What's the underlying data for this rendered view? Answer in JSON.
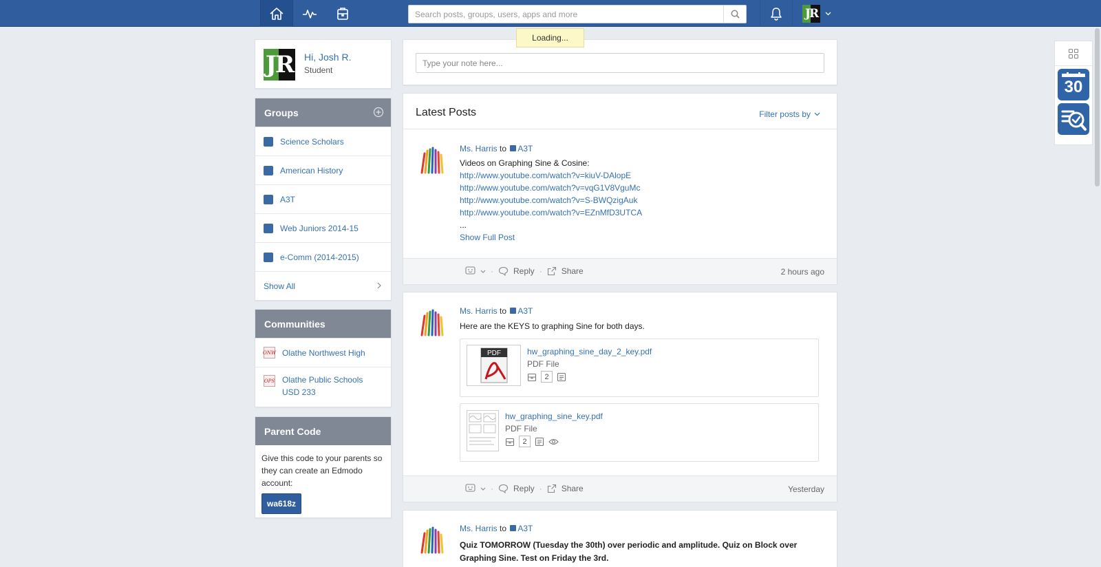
{
  "topbar": {
    "search_placeholder": "Search posts, groups, users, apps and more",
    "loading_text": "Loading...",
    "nav": [
      "home-icon",
      "activity-icon",
      "backpack-icon"
    ]
  },
  "profile": {
    "greeting": "Hi, Josh R.",
    "role": "Student",
    "avatar_letters": "JR"
  },
  "groups": {
    "title": "Groups",
    "items": [
      {
        "label": "Science Scholars"
      },
      {
        "label": "American History"
      },
      {
        "label": "A3T"
      },
      {
        "label": "Web Juniors 2014-15"
      },
      {
        "label": "e-Comm (2014-2015)"
      }
    ],
    "show_all": "Show All"
  },
  "communities": {
    "title": "Communities",
    "items": [
      {
        "label": "Olathe Northwest High"
      },
      {
        "label": "Olathe Public Schools USD 233"
      }
    ]
  },
  "parent_code": {
    "title": "Parent Code",
    "description": "Give this code to your parents so they can create an Edmodo account:",
    "code": "wa618z"
  },
  "note": {
    "placeholder": "Type your note here..."
  },
  "feed": {
    "title": "Latest Posts",
    "filter_label": "Filter posts by",
    "posts": [
      {
        "sender": "Ms. Harris",
        "to": "to",
        "group": "A3T",
        "text": "Videos on Graphing Sine & Cosine:",
        "links": [
          "http://www.youtube.com/watch?v=kiuV-DAlopE",
          "http://www.youtube.com/watch?v=vqG1V8VguMc",
          "http://www.youtube.com/watch?v=S-BWQzigAuk",
          "http://www.youtube.com/watch?v=EZnMfD3UTCA"
        ],
        "ellipsis": "...",
        "show_full": "Show Full Post",
        "reply": "Reply",
        "share": "Share",
        "time": "2 hours ago"
      },
      {
        "sender": "Ms. Harris",
        "to": "to",
        "group": "A3T",
        "text": "Here are the KEYS to graphing Sine for both days.",
        "attachments": [
          {
            "name": "hw_graphing_sine_day_2_key.pdf",
            "type": "PDF File",
            "count": "2"
          },
          {
            "name": "hw_graphing_sine_key.pdf",
            "type": "PDF File",
            "count": "2"
          }
        ],
        "reply": "Reply",
        "share": "Share",
        "time": "Yesterday"
      },
      {
        "sender": "Ms. Harris",
        "to": "to",
        "group": "A3T",
        "text": "Quiz TOMORROW (Tuesday the 30th) over periodic and amplitude. Quiz on Block over Graphing Sine. Test on Friday the 3rd."
      }
    ]
  },
  "rail": {
    "calendar_day": "30"
  },
  "colors": {
    "topbar": "#2f5d9e",
    "link": "#3572b0",
    "panel_header": "#7f8894",
    "group_square": "#3a6aa5"
  }
}
